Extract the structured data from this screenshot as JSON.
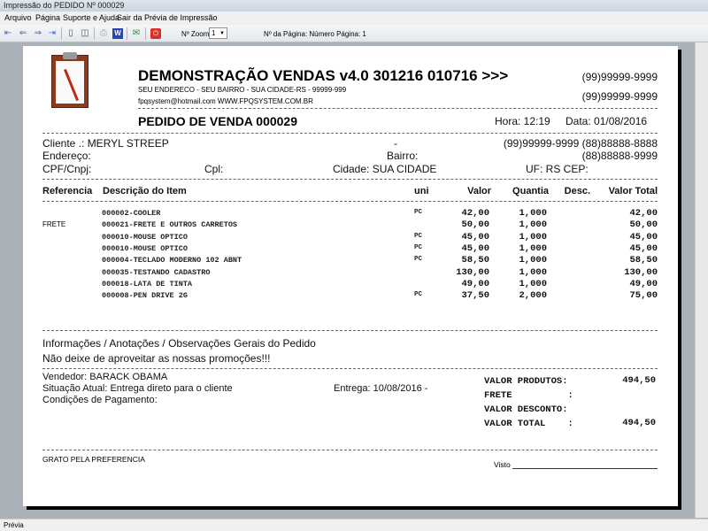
{
  "window": {
    "title": "Impressão do PEDIDO Nº 000029"
  },
  "menu": [
    "Arquivo",
    "Página",
    "Suporte e Ajuda",
    "Sair da Prévia de Impressão"
  ],
  "toolbar": {
    "zoom_label": "Nº Zoom",
    "zoom_value": "1",
    "page_label": "Nº da Página: Número Página: 1"
  },
  "header": {
    "company": "DEMONSTRAÇÃO VENDAS v4.0 301216 010716 >>>",
    "address": "SEU ENDERECO - SEU BAIRRO - SUA CIDADE-RS - 99999-999",
    "contact": "fpqsystem@hotmail.com  WWW.FPQSYSTEM.COM.BR",
    "phone1": "(99)99999-9999",
    "phone2": "(99)99999-9999",
    "order_title": "PEDIDO DE VENDA 000029",
    "time": "Hora: 12:19",
    "date": "Data: 01/08/2016"
  },
  "client": {
    "name": "Cliente   .: MERYL STREEP",
    "dash": "-",
    "phones": "(99)99999-9999  (88)88888-8888",
    "address": "Endereço:",
    "bairro": "Bairro:",
    "phone3": "(88)88888-9999",
    "cpf": "CPF/Cnpj:",
    "cpl": "Cpl:",
    "city": "Cidade: SUA CIDADE",
    "uf": "UF: RS  CEP:"
  },
  "table": {
    "headers": [
      "Referencia",
      "Descrição do Item",
      "uni",
      "Valor",
      "Quantia",
      "Desc.",
      "Valor Total"
    ],
    "rows": [
      {
        "ref": "",
        "desc": "000002-COOLER",
        "uni": "PC",
        "valor": "42,00",
        "qtd": "1,000",
        "total": "42,00"
      },
      {
        "ref": "FRETE",
        "desc": "000021-FRETE E OUTROS CARRETOS",
        "uni": "",
        "valor": "50,00",
        "qtd": "1,000",
        "total": "50,00"
      },
      {
        "ref": "",
        "desc": "000010-MOUSE OPTICO",
        "uni": "PC",
        "valor": "45,00",
        "qtd": "1,000",
        "total": "45,00"
      },
      {
        "ref": "",
        "desc": "000010-MOUSE OPTICO",
        "uni": "PC",
        "valor": "45,00",
        "qtd": "1,000",
        "total": "45,00"
      },
      {
        "ref": "",
        "desc": "000004-TECLADO MODERNO 102 ABNT",
        "uni": "PC",
        "valor": "58,50",
        "qtd": "1,000",
        "total": "58,50"
      },
      {
        "ref": "",
        "desc": "000035-TESTANDO CADASTRO",
        "uni": "",
        "valor": "130,00",
        "qtd": "1,000",
        "total": "130,00"
      },
      {
        "ref": "",
        "desc": "000018-LATA DE TINTA",
        "uni": "",
        "valor": "49,00",
        "qtd": "1,000",
        "total": "49,00"
      },
      {
        "ref": "",
        "desc": "000008-PEN DRIVE 2G",
        "uni": "PC",
        "valor": "37,50",
        "qtd": "2,000",
        "total": "75,00"
      }
    ]
  },
  "notes": {
    "title": "Informações / Anotações / Observações Gerais do Pedido",
    "text": "Não deixe de aproveitar as nossas promoções!!!"
  },
  "footer": {
    "seller": "Vendedor: BARACK OBAMA",
    "status": "Situação Atual: Entrega direto para o cliente",
    "delivery": "Entrega: 10/08/2016 -",
    "payment": "Condições de Pagamento:",
    "totals": [
      {
        "label": "VALOR PRODUTOS:",
        "value": "494,50"
      },
      {
        "label": "FRETE          :",
        "value": ""
      },
      {
        "label": "VALOR DESCONTO:",
        "value": ""
      },
      {
        "label": "VALOR TOTAL    :",
        "value": "494,50"
      }
    ],
    "thanks": "GRATO PELA PREFERENCIA",
    "visto": "Visto"
  },
  "status": {
    "text": "Prévia"
  }
}
